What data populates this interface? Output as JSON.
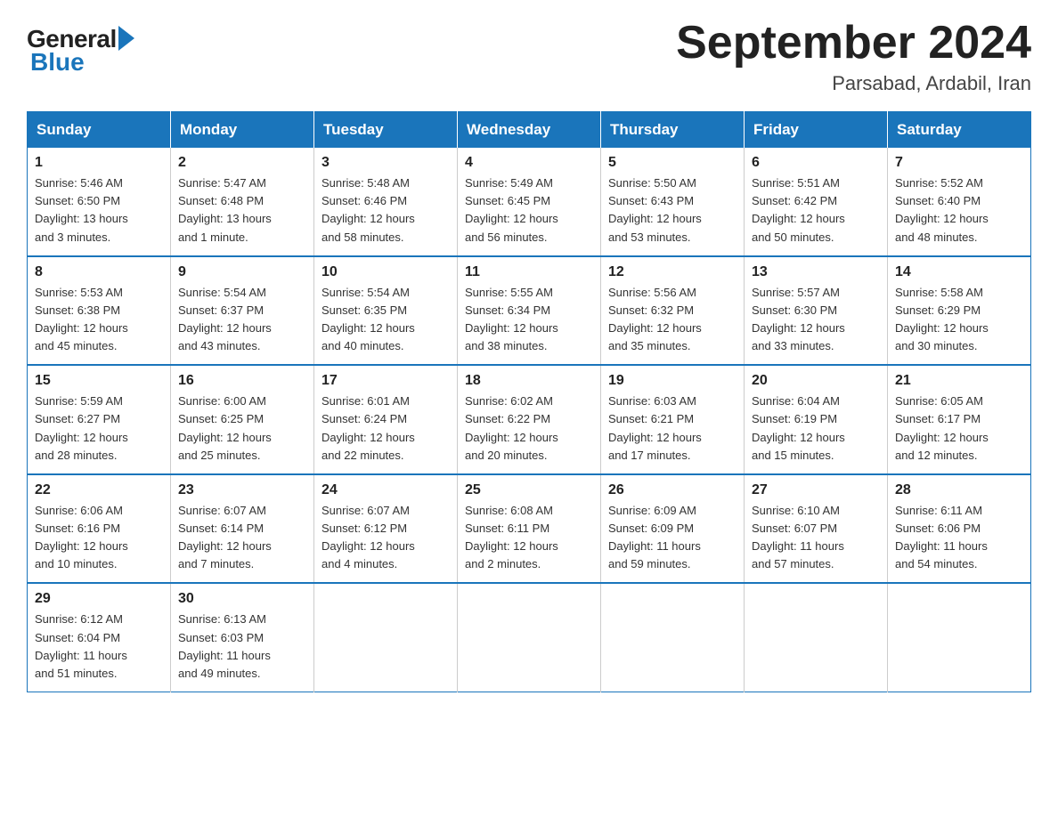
{
  "logo": {
    "general": "General",
    "blue": "Blue"
  },
  "title": "September 2024",
  "subtitle": "Parsabad, Ardabil, Iran",
  "headers": [
    "Sunday",
    "Monday",
    "Tuesday",
    "Wednesday",
    "Thursday",
    "Friday",
    "Saturday"
  ],
  "weeks": [
    [
      {
        "day": "1",
        "info": "Sunrise: 5:46 AM\nSunset: 6:50 PM\nDaylight: 13 hours\nand 3 minutes."
      },
      {
        "day": "2",
        "info": "Sunrise: 5:47 AM\nSunset: 6:48 PM\nDaylight: 13 hours\nand 1 minute."
      },
      {
        "day": "3",
        "info": "Sunrise: 5:48 AM\nSunset: 6:46 PM\nDaylight: 12 hours\nand 58 minutes."
      },
      {
        "day": "4",
        "info": "Sunrise: 5:49 AM\nSunset: 6:45 PM\nDaylight: 12 hours\nand 56 minutes."
      },
      {
        "day": "5",
        "info": "Sunrise: 5:50 AM\nSunset: 6:43 PM\nDaylight: 12 hours\nand 53 minutes."
      },
      {
        "day": "6",
        "info": "Sunrise: 5:51 AM\nSunset: 6:42 PM\nDaylight: 12 hours\nand 50 minutes."
      },
      {
        "day": "7",
        "info": "Sunrise: 5:52 AM\nSunset: 6:40 PM\nDaylight: 12 hours\nand 48 minutes."
      }
    ],
    [
      {
        "day": "8",
        "info": "Sunrise: 5:53 AM\nSunset: 6:38 PM\nDaylight: 12 hours\nand 45 minutes."
      },
      {
        "day": "9",
        "info": "Sunrise: 5:54 AM\nSunset: 6:37 PM\nDaylight: 12 hours\nand 43 minutes."
      },
      {
        "day": "10",
        "info": "Sunrise: 5:54 AM\nSunset: 6:35 PM\nDaylight: 12 hours\nand 40 minutes."
      },
      {
        "day": "11",
        "info": "Sunrise: 5:55 AM\nSunset: 6:34 PM\nDaylight: 12 hours\nand 38 minutes."
      },
      {
        "day": "12",
        "info": "Sunrise: 5:56 AM\nSunset: 6:32 PM\nDaylight: 12 hours\nand 35 minutes."
      },
      {
        "day": "13",
        "info": "Sunrise: 5:57 AM\nSunset: 6:30 PM\nDaylight: 12 hours\nand 33 minutes."
      },
      {
        "day": "14",
        "info": "Sunrise: 5:58 AM\nSunset: 6:29 PM\nDaylight: 12 hours\nand 30 minutes."
      }
    ],
    [
      {
        "day": "15",
        "info": "Sunrise: 5:59 AM\nSunset: 6:27 PM\nDaylight: 12 hours\nand 28 minutes."
      },
      {
        "day": "16",
        "info": "Sunrise: 6:00 AM\nSunset: 6:25 PM\nDaylight: 12 hours\nand 25 minutes."
      },
      {
        "day": "17",
        "info": "Sunrise: 6:01 AM\nSunset: 6:24 PM\nDaylight: 12 hours\nand 22 minutes."
      },
      {
        "day": "18",
        "info": "Sunrise: 6:02 AM\nSunset: 6:22 PM\nDaylight: 12 hours\nand 20 minutes."
      },
      {
        "day": "19",
        "info": "Sunrise: 6:03 AM\nSunset: 6:21 PM\nDaylight: 12 hours\nand 17 minutes."
      },
      {
        "day": "20",
        "info": "Sunrise: 6:04 AM\nSunset: 6:19 PM\nDaylight: 12 hours\nand 15 minutes."
      },
      {
        "day": "21",
        "info": "Sunrise: 6:05 AM\nSunset: 6:17 PM\nDaylight: 12 hours\nand 12 minutes."
      }
    ],
    [
      {
        "day": "22",
        "info": "Sunrise: 6:06 AM\nSunset: 6:16 PM\nDaylight: 12 hours\nand 10 minutes."
      },
      {
        "day": "23",
        "info": "Sunrise: 6:07 AM\nSunset: 6:14 PM\nDaylight: 12 hours\nand 7 minutes."
      },
      {
        "day": "24",
        "info": "Sunrise: 6:07 AM\nSunset: 6:12 PM\nDaylight: 12 hours\nand 4 minutes."
      },
      {
        "day": "25",
        "info": "Sunrise: 6:08 AM\nSunset: 6:11 PM\nDaylight: 12 hours\nand 2 minutes."
      },
      {
        "day": "26",
        "info": "Sunrise: 6:09 AM\nSunset: 6:09 PM\nDaylight: 11 hours\nand 59 minutes."
      },
      {
        "day": "27",
        "info": "Sunrise: 6:10 AM\nSunset: 6:07 PM\nDaylight: 11 hours\nand 57 minutes."
      },
      {
        "day": "28",
        "info": "Sunrise: 6:11 AM\nSunset: 6:06 PM\nDaylight: 11 hours\nand 54 minutes."
      }
    ],
    [
      {
        "day": "29",
        "info": "Sunrise: 6:12 AM\nSunset: 6:04 PM\nDaylight: 11 hours\nand 51 minutes."
      },
      {
        "day": "30",
        "info": "Sunrise: 6:13 AM\nSunset: 6:03 PM\nDaylight: 11 hours\nand 49 minutes."
      },
      {
        "day": "",
        "info": ""
      },
      {
        "day": "",
        "info": ""
      },
      {
        "day": "",
        "info": ""
      },
      {
        "day": "",
        "info": ""
      },
      {
        "day": "",
        "info": ""
      }
    ]
  ]
}
